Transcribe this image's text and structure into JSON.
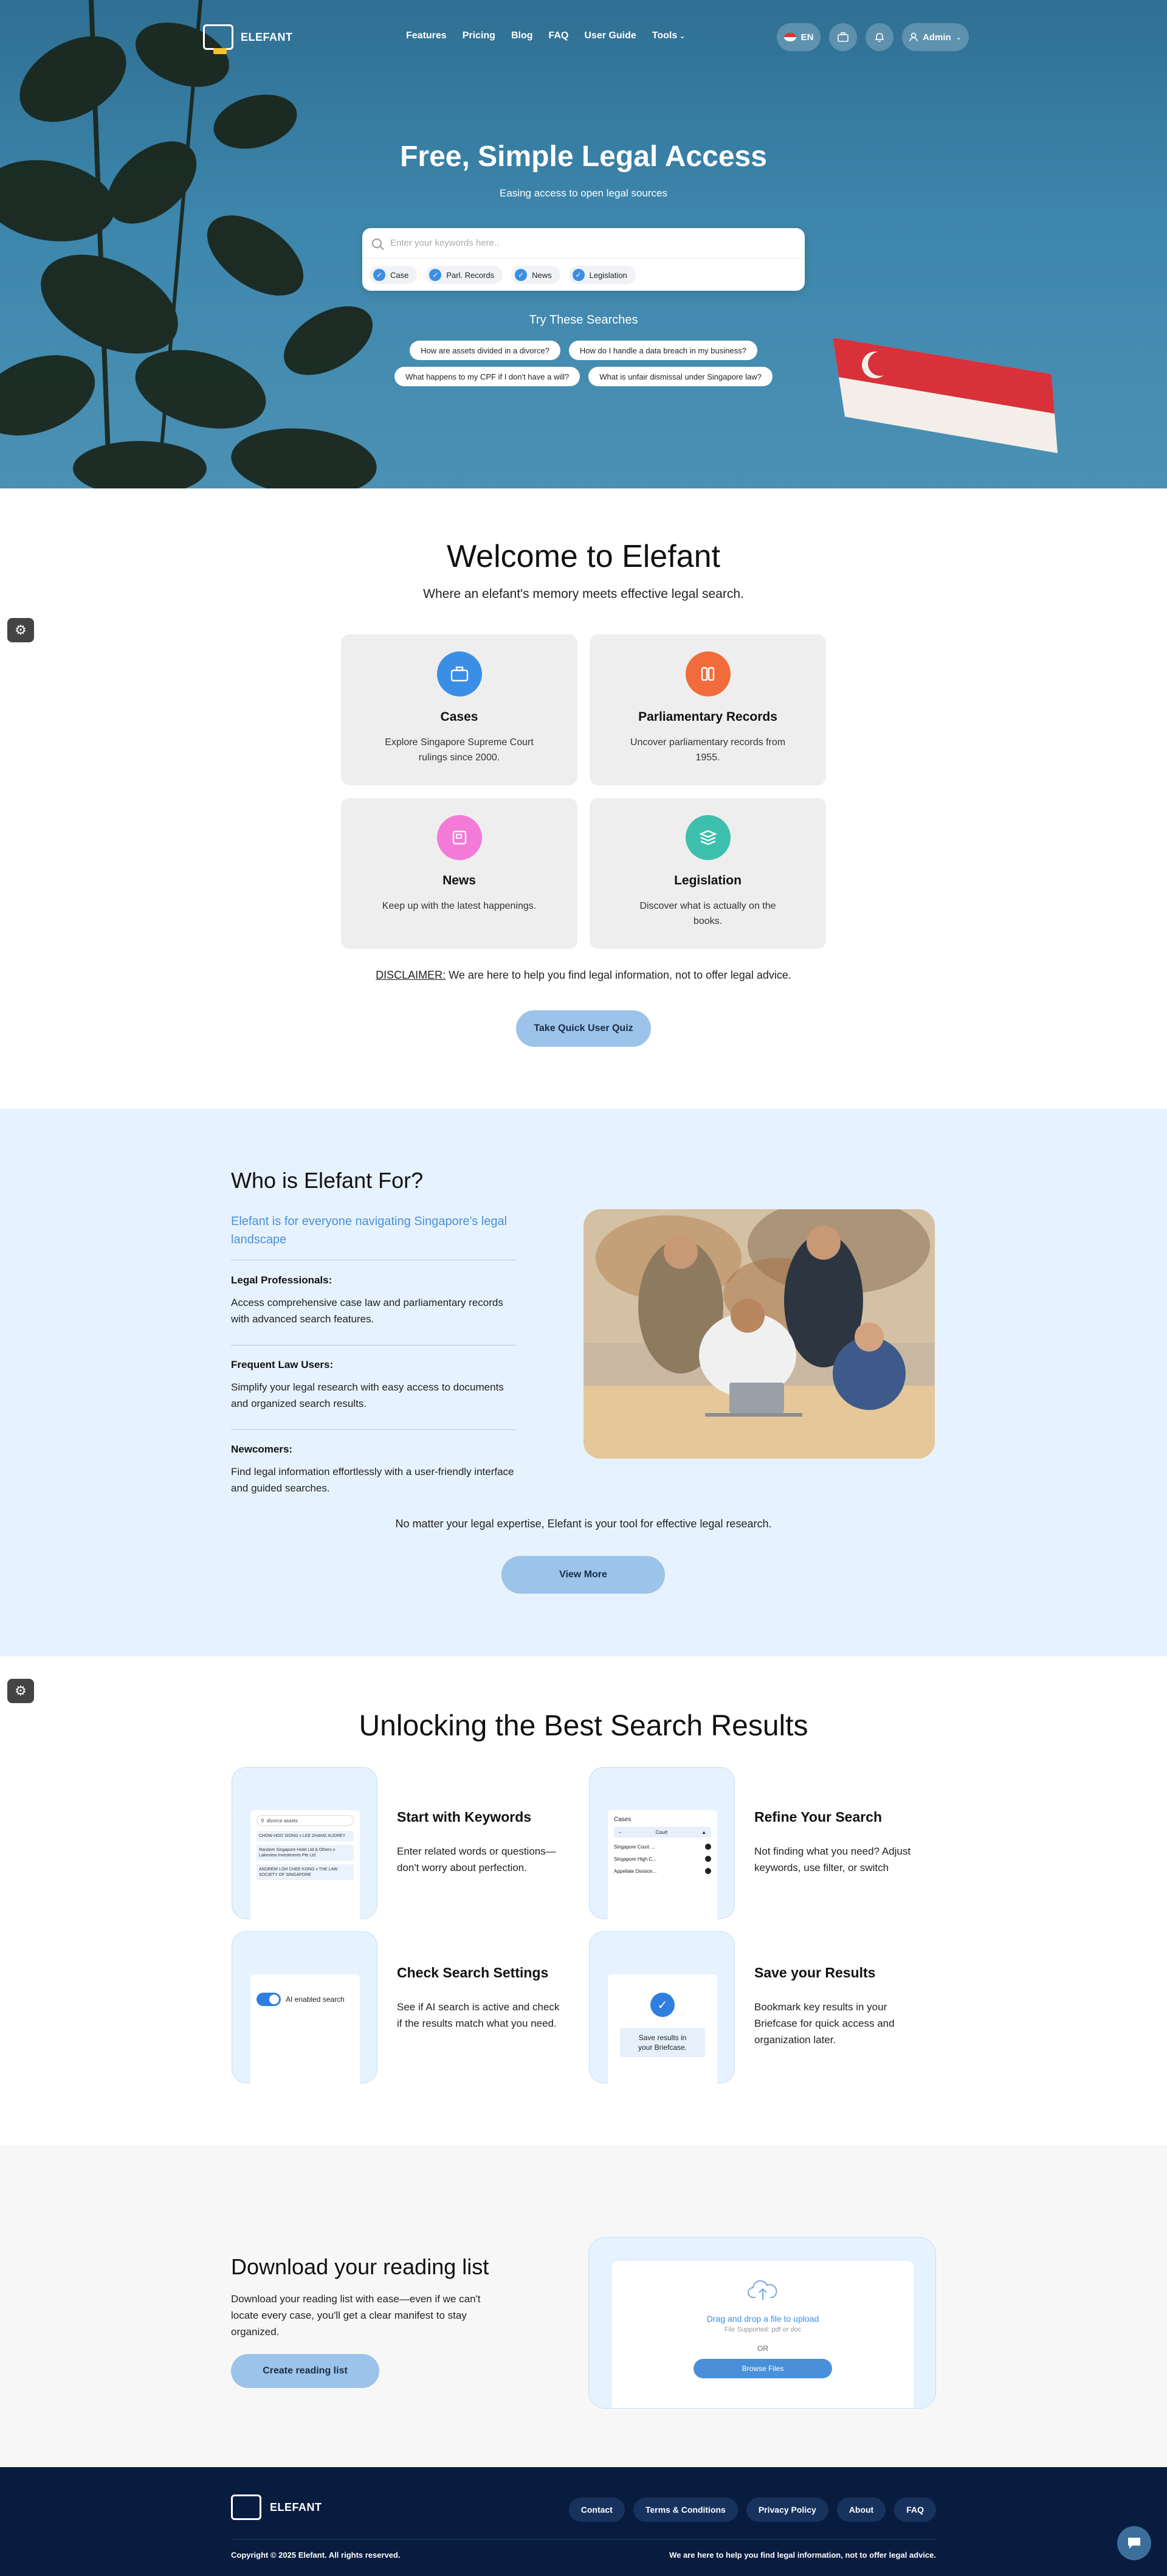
{
  "header": {
    "brand": "ELEFANT",
    "nav": [
      "Features",
      "Pricing",
      "Blog",
      "FAQ",
      "User Guide",
      "Tools"
    ],
    "lang": "EN",
    "admin_label": "Admin"
  },
  "hero": {
    "title": "Free, Simple Legal Access",
    "subtitle": "Easing access to open legal sources",
    "search_placeholder": "Enter your keywords here..",
    "filters": [
      "Case",
      "Parl. Records",
      "News",
      "Legislation"
    ],
    "try_title": "Try These Searches",
    "try_row1": [
      "How are assets divided in a divorce?",
      "How do I handle a data breach in my business?"
    ],
    "try_row2": [
      "What happens to my CPF if I don't have a will?",
      "What is unfair dismissal under Singapore law?"
    ]
  },
  "welcome": {
    "title": "Welcome to Elefant",
    "subtitle": "Where an elefant's memory meets effective legal search.",
    "cards": [
      {
        "title": "Cases",
        "desc": "Explore Singapore Supreme Court rulings since 2000.",
        "color": "#3a8ee6",
        "icon": "briefcase-icon"
      },
      {
        "title": "Parliamentary Records",
        "desc": "Uncover parliamentary records from 1955.",
        "color": "#f26b3a",
        "icon": "books-icon"
      },
      {
        "title": "News",
        "desc": "Keep up with the latest happenings.",
        "color": "#f47ad8",
        "icon": "newspaper-icon"
      },
      {
        "title": "Legislation",
        "desc": "Discover what is actually on the books.",
        "color": "#3dbfae",
        "icon": "stack-icon"
      }
    ],
    "disclaimer_label": "DISCLAIMER:",
    "disclaimer_text": " We are here to help you find legal information, not to offer legal advice.",
    "quiz_button": "Take Quick User Quiz"
  },
  "who": {
    "title": "Who is Elefant For?",
    "tagline": "Elefant is for everyone navigating Singapore's legal landscape",
    "groups": [
      {
        "title": "Legal Professionals:",
        "desc": "Access comprehensive case law and parliamentary records with advanced search features."
      },
      {
        "title": "Frequent Law Users:",
        "desc": "Simplify your legal research with easy access to documents and organized search results."
      },
      {
        "title": "Newcomers:",
        "desc": "Find legal information effortlessly with a user-friendly interface and guided searches."
      }
    ],
    "footnote": "No matter your legal expertise, Elefant is your tool for effective legal research.",
    "view_more": "View More"
  },
  "unlock": {
    "title": "Unlocking the Best Search Results",
    "features": [
      {
        "title": "Start with Keywords",
        "desc": "Enter related words or questions—don't worry about perfection."
      },
      {
        "title": "Refine Your Search",
        "desc": "Not finding what you need? Adjust keywords, use filter, or switch"
      },
      {
        "title": "Check Search Settings",
        "desc": "See if AI search is active and check if the results match what you need."
      },
      {
        "title": "Save your Results",
        "desc": "Bookmark key results in your Briefcase for quick access and organization later."
      }
    ],
    "tile1": {
      "search": "divorce assets",
      "rows": [
        "CHOW HOO SIONG v LEE ZHANG AUDREY",
        "Random Singapore Hotel Ltd & Others v Lakeview Investments Pte Ltd",
        "ANDREW LOH CHEE KONG v THE LAW SOCIETY OF SINGAPORE"
      ]
    },
    "tile2": {
      "label": "Cases",
      "select": "Court",
      "rows": [
        "Singapore Court ...",
        "Singapore High C...",
        "Appellate Division..."
      ]
    },
    "tile3": {
      "toggle": "AI enabled search"
    },
    "tile4": {
      "note": "Save results in your Briefcase."
    }
  },
  "download": {
    "title": "Download your reading list",
    "desc": "Download your reading list with ease—even if we can't locate every case, you'll get a clear manifest to stay organized.",
    "button": "Create reading list",
    "drop_text": "Drag and drop a file to upload",
    "supported": "File Supported: pdf or doc",
    "or": "OR",
    "browse": "Browse Files"
  },
  "footer": {
    "brand": "ELEFANT",
    "links": [
      "Contact",
      "Terms & Conditions",
      "Privacy Policy",
      "About",
      "FAQ"
    ],
    "copyright": "Copyright © 2025 Elefant. All rights reserved.",
    "disclaimer": "We are here to help you find legal information, not to offer legal advice."
  }
}
